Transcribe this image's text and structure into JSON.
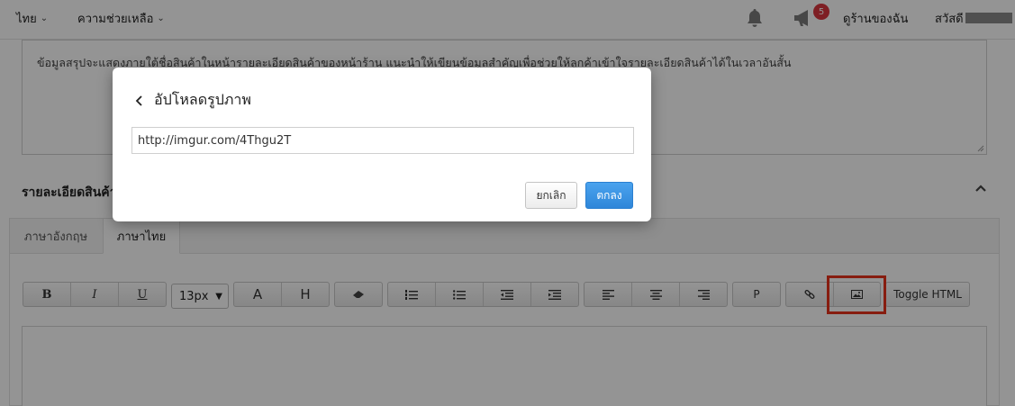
{
  "nav": {
    "language": "ไทย",
    "help": "ความช่วยเหลือ",
    "notification_count": "5",
    "my_shop": "ดูร้านของฉัน",
    "greeting": "สวัสดี",
    "icons": [
      "chevron-down-icon",
      "bell-icon",
      "megaphone-icon"
    ]
  },
  "summary": {
    "hint": "ข้อมูลสรุปจะแสดงภายใต้ชื่อสินค้าในหน้ารายละเอียดสินค้าของหน้าร้าน แนะนำให้เขียนข้อมูลสำคัญเพื่อช่วยให้ลูกค้าเข้าใจรายละเอียดสินค้าได้ในเวลาอันสั้น"
  },
  "section": {
    "title": "รายละเอียดสินค้า"
  },
  "tabs": [
    {
      "label": "ภาษาอังกฤษ",
      "active": false
    },
    {
      "label": "ภาษาไทย",
      "active": true
    }
  ],
  "toolbar": {
    "bold": "B",
    "italic": "I",
    "underline": "U",
    "font_size": "13px",
    "font_color": "A",
    "highlight": "H",
    "paragraph": "P",
    "toggle_html": "Toggle HTML"
  },
  "modal": {
    "title": "อัปโหลดรูปภาพ",
    "url_value": "http://imgur.com/4Thgu2T",
    "cancel_label": "ยกเลิก",
    "ok_label": "ตกลง"
  },
  "colors": {
    "primary_button": "#2f86d9",
    "badge": "#d9363e",
    "highlight_box": "#e8321c"
  }
}
